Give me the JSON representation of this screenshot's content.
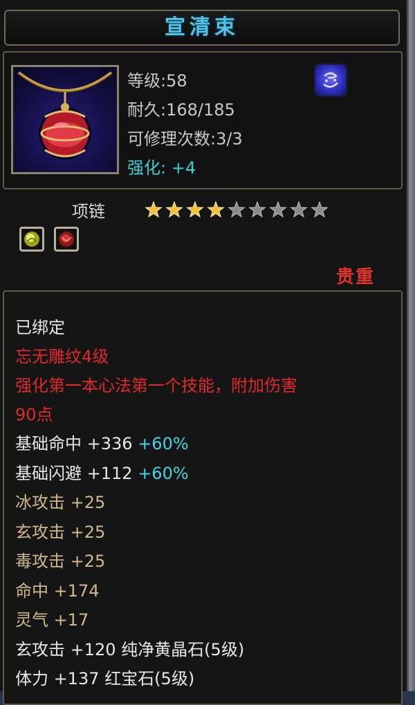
{
  "item": {
    "name": "宣清束",
    "level": "等级:58",
    "durability": "耐久:168/185",
    "repair_count": "可修理次数:3/3",
    "enhance": "强化: +4",
    "type": "项链",
    "stars_filled": 4,
    "stars_total": 9,
    "quality": "贵重",
    "bound": "已绑定",
    "effect_name": "忘无雕纹4级",
    "effect_desc_line1": "强化第一本心法第一个技能，附加伤害",
    "effect_desc_line2": "90点",
    "attributes": [
      {
        "name": "基础命中",
        "value": "+336",
        "bonus": "+60%"
      },
      {
        "name": "基础闪避",
        "value": "+112",
        "bonus": "+60%"
      },
      {
        "name": "冰攻击",
        "value": "+25",
        "bonus": ""
      },
      {
        "name": "玄攻击",
        "value": "+25",
        "bonus": ""
      },
      {
        "name": "毒攻击",
        "value": "+25",
        "bonus": ""
      },
      {
        "name": "命中",
        "value": "+174",
        "bonus": ""
      },
      {
        "name": "灵气",
        "value": "+17",
        "bonus": ""
      }
    ],
    "gem_lines": [
      {
        "name": "玄攻击",
        "value": "+120",
        "gem": "纯净黄晶石(5级)"
      },
      {
        "name": "体力",
        "value": "+137",
        "gem": "红宝石(5级)"
      }
    ]
  },
  "icons": {
    "item_icon": "necklace-icon",
    "badge_icon": "heart-rune-icon",
    "gem_slot_1": "yellow-gem-icon",
    "gem_slot_2": "red-gem-icon"
  },
  "colors": {
    "title": "#4fc3e8",
    "enhance": "#34d1d6",
    "quality": "#e0332b",
    "effect": "#e02a2a",
    "bonus": "#40d4e4",
    "attribute": "#d0b98a"
  }
}
